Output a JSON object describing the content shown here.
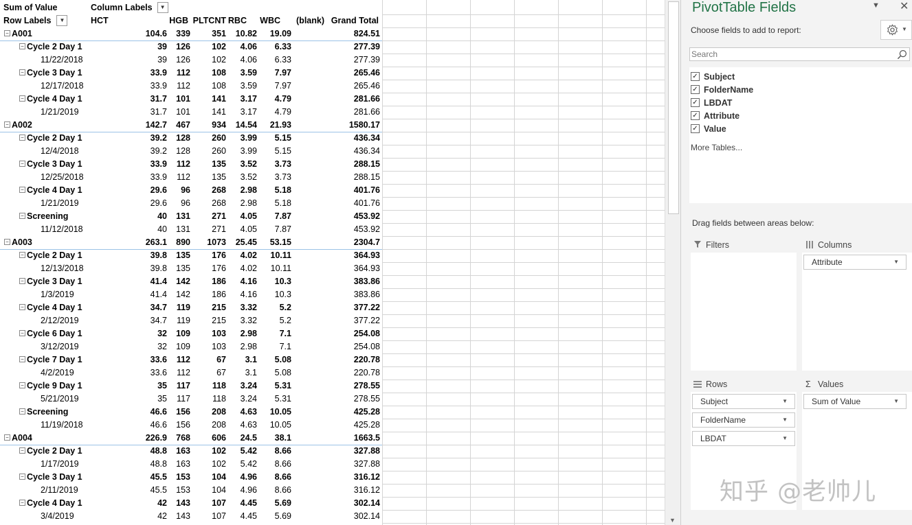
{
  "pivot": {
    "corner_label": "Sum of Value",
    "column_labels": "Column Labels",
    "row_labels": "Row Labels",
    "columns": [
      "HCT",
      "HGB",
      "PLTCNT",
      "RBC",
      "WBC",
      "(blank)",
      "Grand Total"
    ],
    "rows": [
      {
        "level": 0,
        "label": "A001",
        "values": [
          "104.6",
          "339",
          "351",
          "10.82",
          "19.09",
          "",
          "824.51"
        ]
      },
      {
        "level": 1,
        "label": "Cycle 2 Day 1",
        "values": [
          "39",
          "126",
          "102",
          "4.06",
          "6.33",
          "",
          "277.39"
        ]
      },
      {
        "level": 2,
        "label": "11/22/2018",
        "values": [
          "39",
          "126",
          "102",
          "4.06",
          "6.33",
          "",
          "277.39"
        ]
      },
      {
        "level": 1,
        "label": "Cycle 3 Day 1",
        "values": [
          "33.9",
          "112",
          "108",
          "3.59",
          "7.97",
          "",
          "265.46"
        ]
      },
      {
        "level": 2,
        "label": "12/17/2018",
        "values": [
          "33.9",
          "112",
          "108",
          "3.59",
          "7.97",
          "",
          "265.46"
        ]
      },
      {
        "level": 1,
        "label": "Cycle 4 Day 1",
        "values": [
          "31.7",
          "101",
          "141",
          "3.17",
          "4.79",
          "",
          "281.66"
        ]
      },
      {
        "level": 2,
        "label": "1/21/2019",
        "values": [
          "31.7",
          "101",
          "141",
          "3.17",
          "4.79",
          "",
          "281.66"
        ]
      },
      {
        "level": 0,
        "label": "A002",
        "values": [
          "142.7",
          "467",
          "934",
          "14.54",
          "21.93",
          "",
          "1580.17"
        ]
      },
      {
        "level": 1,
        "label": "Cycle 2 Day 1",
        "values": [
          "39.2",
          "128",
          "260",
          "3.99",
          "5.15",
          "",
          "436.34"
        ]
      },
      {
        "level": 2,
        "label": "12/4/2018",
        "values": [
          "39.2",
          "128",
          "260",
          "3.99",
          "5.15",
          "",
          "436.34"
        ]
      },
      {
        "level": 1,
        "label": "Cycle 3 Day 1",
        "values": [
          "33.9",
          "112",
          "135",
          "3.52",
          "3.73",
          "",
          "288.15"
        ]
      },
      {
        "level": 2,
        "label": "12/25/2018",
        "values": [
          "33.9",
          "112",
          "135",
          "3.52",
          "3.73",
          "",
          "288.15"
        ]
      },
      {
        "level": 1,
        "label": "Cycle 4 Day 1",
        "values": [
          "29.6",
          "96",
          "268",
          "2.98",
          "5.18",
          "",
          "401.76"
        ]
      },
      {
        "level": 2,
        "label": "1/21/2019",
        "values": [
          "29.6",
          "96",
          "268",
          "2.98",
          "5.18",
          "",
          "401.76"
        ]
      },
      {
        "level": 1,
        "label": "Screening",
        "values": [
          "40",
          "131",
          "271",
          "4.05",
          "7.87",
          "",
          "453.92"
        ]
      },
      {
        "level": 2,
        "label": "11/12/2018",
        "values": [
          "40",
          "131",
          "271",
          "4.05",
          "7.87",
          "",
          "453.92"
        ]
      },
      {
        "level": 0,
        "label": "A003",
        "values": [
          "263.1",
          "890",
          "1073",
          "25.45",
          "53.15",
          "",
          "2304.7"
        ]
      },
      {
        "level": 1,
        "label": "Cycle 2 Day 1",
        "values": [
          "39.8",
          "135",
          "176",
          "4.02",
          "10.11",
          "",
          "364.93"
        ]
      },
      {
        "level": 2,
        "label": "12/13/2018",
        "values": [
          "39.8",
          "135",
          "176",
          "4.02",
          "10.11",
          "",
          "364.93"
        ]
      },
      {
        "level": 1,
        "label": "Cycle 3 Day 1",
        "values": [
          "41.4",
          "142",
          "186",
          "4.16",
          "10.3",
          "",
          "383.86"
        ]
      },
      {
        "level": 2,
        "label": "1/3/2019",
        "values": [
          "41.4",
          "142",
          "186",
          "4.16",
          "10.3",
          "",
          "383.86"
        ]
      },
      {
        "level": 1,
        "label": "Cycle 4 Day 1",
        "values": [
          "34.7",
          "119",
          "215",
          "3.32",
          "5.2",
          "",
          "377.22"
        ]
      },
      {
        "level": 2,
        "label": "2/12/2019",
        "values": [
          "34.7",
          "119",
          "215",
          "3.32",
          "5.2",
          "",
          "377.22"
        ]
      },
      {
        "level": 1,
        "label": "Cycle 6 Day 1",
        "values": [
          "32",
          "109",
          "103",
          "2.98",
          "7.1",
          "",
          "254.08"
        ]
      },
      {
        "level": 2,
        "label": "3/12/2019",
        "values": [
          "32",
          "109",
          "103",
          "2.98",
          "7.1",
          "",
          "254.08"
        ]
      },
      {
        "level": 1,
        "label": "Cycle 7 Day 1",
        "values": [
          "33.6",
          "112",
          "67",
          "3.1",
          "5.08",
          "",
          "220.78"
        ]
      },
      {
        "level": 2,
        "label": "4/2/2019",
        "values": [
          "33.6",
          "112",
          "67",
          "3.1",
          "5.08",
          "",
          "220.78"
        ]
      },
      {
        "level": 1,
        "label": "Cycle 9 Day 1",
        "values": [
          "35",
          "117",
          "118",
          "3.24",
          "5.31",
          "",
          "278.55"
        ]
      },
      {
        "level": 2,
        "label": "5/21/2019",
        "values": [
          "35",
          "117",
          "118",
          "3.24",
          "5.31",
          "",
          "278.55"
        ]
      },
      {
        "level": 1,
        "label": "Screening",
        "values": [
          "46.6",
          "156",
          "208",
          "4.63",
          "10.05",
          "",
          "425.28"
        ]
      },
      {
        "level": 2,
        "label": "11/19/2018",
        "values": [
          "46.6",
          "156",
          "208",
          "4.63",
          "10.05",
          "",
          "425.28"
        ]
      },
      {
        "level": 0,
        "label": "A004",
        "values": [
          "226.9",
          "768",
          "606",
          "24.5",
          "38.1",
          "",
          "1663.5"
        ]
      },
      {
        "level": 1,
        "label": "Cycle 2 Day 1",
        "values": [
          "48.8",
          "163",
          "102",
          "5.42",
          "8.66",
          "",
          "327.88"
        ]
      },
      {
        "level": 2,
        "label": "1/17/2019",
        "values": [
          "48.8",
          "163",
          "102",
          "5.42",
          "8.66",
          "",
          "327.88"
        ]
      },
      {
        "level": 1,
        "label": "Cycle 3 Day 1",
        "values": [
          "45.5",
          "153",
          "104",
          "4.96",
          "8.66",
          "",
          "316.12"
        ]
      },
      {
        "level": 2,
        "label": "2/11/2019",
        "values": [
          "45.5",
          "153",
          "104",
          "4.96",
          "8.66",
          "",
          "316.12"
        ]
      },
      {
        "level": 1,
        "label": "Cycle 4 Day 1",
        "values": [
          "42",
          "143",
          "107",
          "4.45",
          "5.69",
          "",
          "302.14"
        ]
      },
      {
        "level": 2,
        "label": "3/4/2019",
        "values": [
          "42",
          "143",
          "107",
          "4.45",
          "5.69",
          "",
          "302.14"
        ]
      }
    ]
  },
  "pane": {
    "title": "PivotTable Fields",
    "choose_label": "Choose fields to add to report:",
    "gear_icon": "gear-icon",
    "search_placeholder": "Search",
    "fields": [
      {
        "label": "Subject",
        "checked": true
      },
      {
        "label": "FolderName",
        "checked": true
      },
      {
        "label": "LBDAT",
        "checked": true
      },
      {
        "label": "Attribute",
        "checked": true
      },
      {
        "label": "Value",
        "checked": true
      }
    ],
    "more_tables": "More Tables...",
    "drag_label": "Drag fields between areas below:",
    "areas": {
      "filters": {
        "title": "Filters",
        "items": []
      },
      "columns": {
        "title": "Columns",
        "items": [
          "Attribute"
        ]
      },
      "rows": {
        "title": "Rows",
        "items": [
          "Subject",
          "FolderName",
          "LBDAT"
        ]
      },
      "values": {
        "title": "Values",
        "items": [
          "Sum of Value"
        ]
      }
    }
  },
  "watermark": "知乎 @老帅儿",
  "colors": {
    "accent": "#217346",
    "subject_border": "#9bc2e6"
  }
}
